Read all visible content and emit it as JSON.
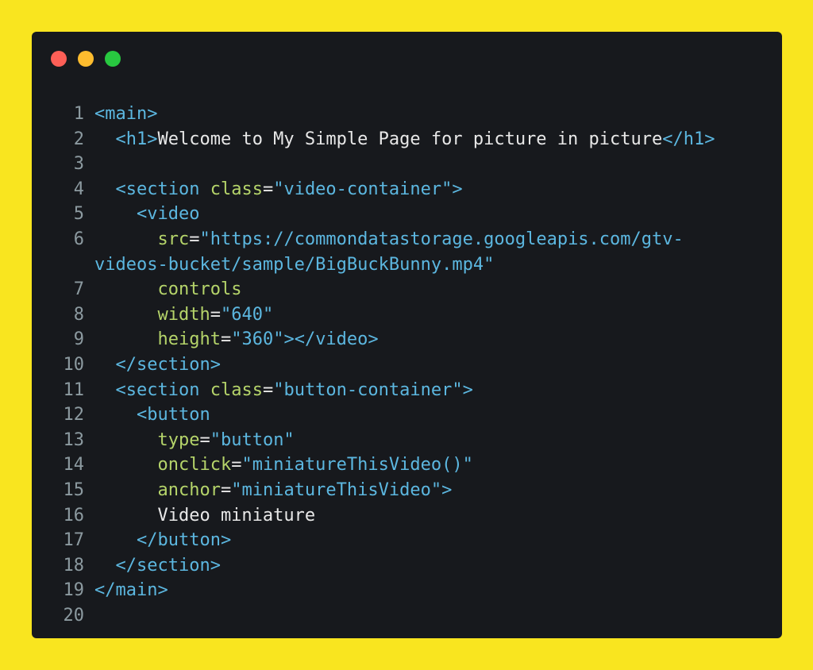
{
  "colors": {
    "background": "#f9e51f",
    "window": "#17191d",
    "tag": "#5cb7e0",
    "attribute": "#b5d46a",
    "string": "#5cb7e0",
    "text": "#e8e8e8",
    "line_number": "#8c9aa0"
  },
  "window_controls": [
    "close-dot-icon",
    "minimize-dot-icon",
    "maximize-dot-icon"
  ],
  "code": {
    "lines": [
      {
        "n": "1",
        "tokens": [
          {
            "t": "tag",
            "v": "<main>"
          }
        ]
      },
      {
        "n": "2",
        "tokens": [
          {
            "t": "plain",
            "v": "  "
          },
          {
            "t": "tag",
            "v": "<h1>"
          },
          {
            "t": "plain",
            "v": "Welcome to My Simple Page for picture in picture"
          },
          {
            "t": "tag",
            "v": "</h1>"
          }
        ]
      },
      {
        "n": "3",
        "tokens": []
      },
      {
        "n": "4",
        "tokens": [
          {
            "t": "plain",
            "v": "  "
          },
          {
            "t": "tag",
            "v": "<section "
          },
          {
            "t": "attr",
            "v": "class"
          },
          {
            "t": "plain",
            "v": "="
          },
          {
            "t": "str",
            "v": "\"video-container\""
          },
          {
            "t": "tag",
            "v": ">"
          }
        ]
      },
      {
        "n": "5",
        "tokens": [
          {
            "t": "plain",
            "v": "    "
          },
          {
            "t": "tag",
            "v": "<video"
          }
        ]
      },
      {
        "n": "6",
        "tokens": [
          {
            "t": "plain",
            "v": "      "
          },
          {
            "t": "attr",
            "v": "src"
          },
          {
            "t": "plain",
            "v": "="
          },
          {
            "t": "str",
            "v": "\"https://commondatastorage.googleapis.com/gtv-"
          }
        ],
        "wrap": [
          {
            "t": "str",
            "v": "videos-bucket/sample/BigBuckBunny.mp4\""
          }
        ]
      },
      {
        "n": "7",
        "tokens": [
          {
            "t": "plain",
            "v": "      "
          },
          {
            "t": "attr",
            "v": "controls"
          }
        ]
      },
      {
        "n": "8",
        "tokens": [
          {
            "t": "plain",
            "v": "      "
          },
          {
            "t": "attr",
            "v": "width"
          },
          {
            "t": "plain",
            "v": "="
          },
          {
            "t": "str",
            "v": "\"640\""
          }
        ]
      },
      {
        "n": "9",
        "tokens": [
          {
            "t": "plain",
            "v": "      "
          },
          {
            "t": "attr",
            "v": "height"
          },
          {
            "t": "plain",
            "v": "="
          },
          {
            "t": "str",
            "v": "\"360\""
          },
          {
            "t": "tag",
            "v": "></video>"
          }
        ]
      },
      {
        "n": "10",
        "tokens": [
          {
            "t": "plain",
            "v": "  "
          },
          {
            "t": "tag",
            "v": "</section>"
          }
        ]
      },
      {
        "n": "11",
        "tokens": [
          {
            "t": "plain",
            "v": "  "
          },
          {
            "t": "tag",
            "v": "<section "
          },
          {
            "t": "attr",
            "v": "class"
          },
          {
            "t": "plain",
            "v": "="
          },
          {
            "t": "str",
            "v": "\"button-container\""
          },
          {
            "t": "tag",
            "v": ">"
          }
        ]
      },
      {
        "n": "12",
        "tokens": [
          {
            "t": "plain",
            "v": "    "
          },
          {
            "t": "tag",
            "v": "<button"
          }
        ]
      },
      {
        "n": "13",
        "tokens": [
          {
            "t": "plain",
            "v": "      "
          },
          {
            "t": "attr",
            "v": "type"
          },
          {
            "t": "plain",
            "v": "="
          },
          {
            "t": "str",
            "v": "\"button\""
          }
        ]
      },
      {
        "n": "14",
        "tokens": [
          {
            "t": "plain",
            "v": "      "
          },
          {
            "t": "attr",
            "v": "onclick"
          },
          {
            "t": "plain",
            "v": "="
          },
          {
            "t": "str",
            "v": "\"miniatureThisVideo()\""
          }
        ]
      },
      {
        "n": "15",
        "tokens": [
          {
            "t": "plain",
            "v": "      "
          },
          {
            "t": "attr",
            "v": "anchor"
          },
          {
            "t": "plain",
            "v": "="
          },
          {
            "t": "str",
            "v": "\"miniatureThisVideo\""
          },
          {
            "t": "tag",
            "v": ">"
          }
        ]
      },
      {
        "n": "16",
        "tokens": [
          {
            "t": "plain",
            "v": "      Video miniature"
          }
        ]
      },
      {
        "n": "17",
        "tokens": [
          {
            "t": "plain",
            "v": "    "
          },
          {
            "t": "tag",
            "v": "</button>"
          }
        ]
      },
      {
        "n": "18",
        "tokens": [
          {
            "t": "plain",
            "v": "  "
          },
          {
            "t": "tag",
            "v": "</section>"
          }
        ]
      },
      {
        "n": "19",
        "tokens": [
          {
            "t": "tag",
            "v": "</main>"
          }
        ]
      },
      {
        "n": "20",
        "tokens": []
      }
    ]
  }
}
